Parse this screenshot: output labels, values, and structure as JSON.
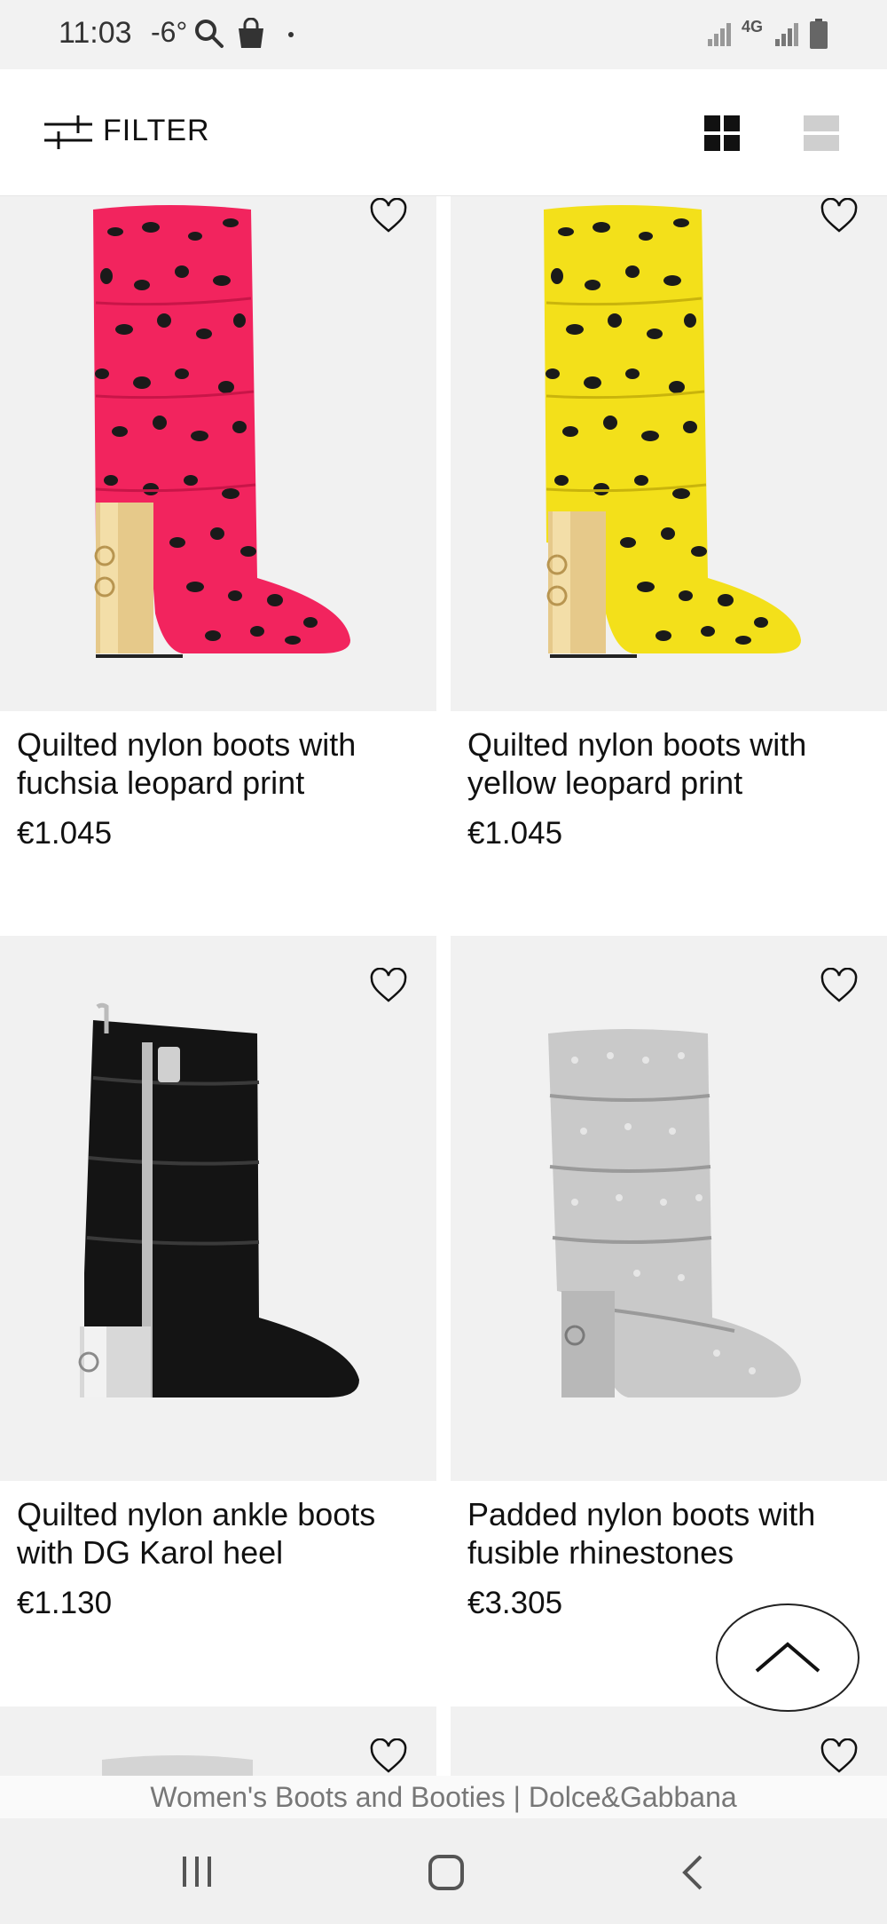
{
  "status": {
    "time": "11:03",
    "temperature": "-6°",
    "network": "4G"
  },
  "toolbar": {
    "filter_label": "FILTER"
  },
  "products": [
    {
      "title": "Quilted nylon boots with fuchsia leopard print",
      "price": "€1.045"
    },
    {
      "title": "Quilted nylon boots with yellow leopard print",
      "price": "€1.045"
    },
    {
      "title": "Quilted nylon ankle boots with DG Karol heel",
      "price": "€1.130"
    },
    {
      "title": "Padded nylon boots with fusible rhinestones",
      "price": "€3.305"
    }
  ],
  "page": {
    "title": "Women's Boots and Booties | Dolce&Gabbana"
  },
  "colors": {
    "fuchsia": "#f2245e",
    "yellow": "#f3e01a",
    "black_boot": "#141414",
    "silver_boot": "#c9c9c9",
    "card_bg": "#f1f1f1"
  }
}
